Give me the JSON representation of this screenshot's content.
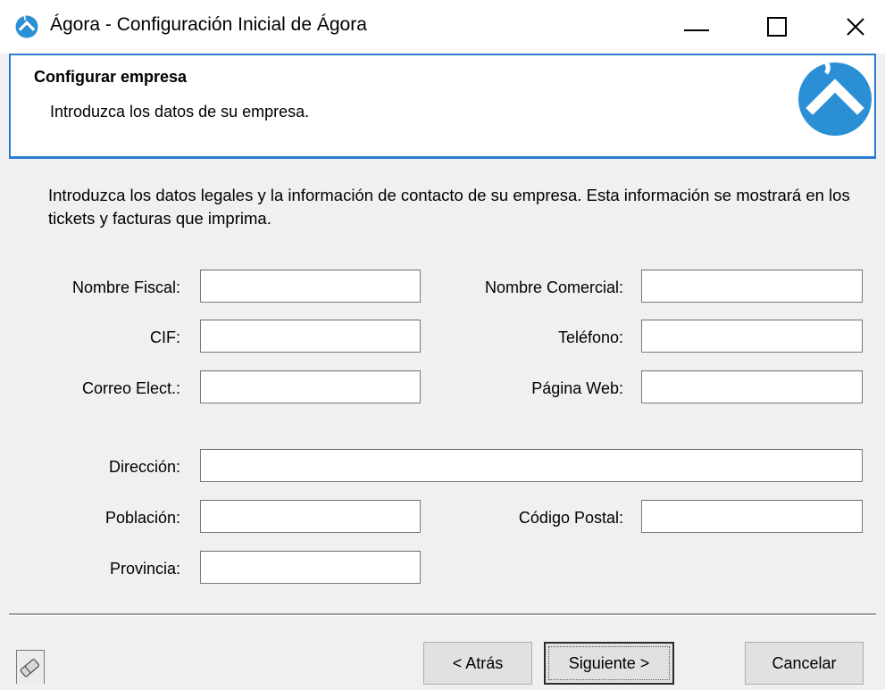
{
  "window": {
    "title": "Ágora - Configuración Inicial de Ágora",
    "icon": "agora-logo-icon",
    "controls": [
      "minimize-icon",
      "maximize-icon",
      "close-icon"
    ]
  },
  "header": {
    "title": "Configurar empresa",
    "subtitle": "Introduzca los datos de su empresa.",
    "accent_color": "#2b7bd1"
  },
  "intro": "Introduzca los datos legales y la información de contacto de su empresa. Esta información se mostrará en los tickets y facturas que imprima.",
  "form": {
    "nombre_fiscal": {
      "label": "Nombre Fiscal:",
      "value": ""
    },
    "nombre_comercial": {
      "label": "Nombre Comercial:",
      "value": ""
    },
    "cif": {
      "label": "CIF:",
      "value": ""
    },
    "telefono": {
      "label": "Teléfono:",
      "value": ""
    },
    "correo": {
      "label": "Correo Elect.:",
      "value": ""
    },
    "pagina_web": {
      "label": "Página Web:",
      "value": ""
    },
    "direccion": {
      "label": "Dirección:",
      "value": ""
    },
    "poblacion": {
      "label": "Población:",
      "value": ""
    },
    "codigo_postal": {
      "label": "Código Postal:",
      "value": ""
    },
    "provincia": {
      "label": "Provincia:",
      "value": ""
    }
  },
  "footer": {
    "help_icon": "eraser-icon",
    "back_label": "< Atrás",
    "next_label": "Siguiente >",
    "cancel_label": "Cancelar"
  }
}
